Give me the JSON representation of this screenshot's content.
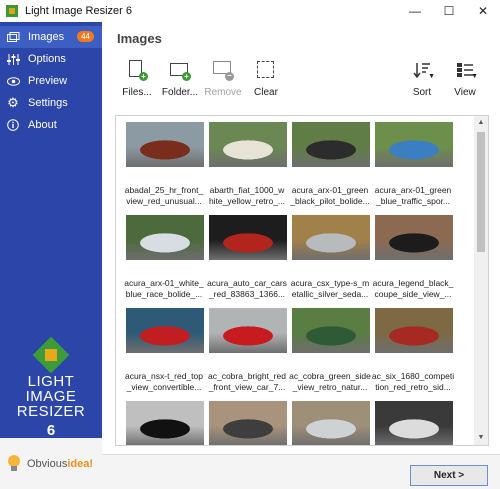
{
  "window": {
    "title": "Light Image Resizer 6",
    "buttons": [
      "minimize",
      "maximize",
      "close"
    ]
  },
  "sidebar": {
    "items": [
      {
        "label": "Images",
        "icon": "images-icon",
        "badge": "44",
        "active": true
      },
      {
        "label": "Options",
        "icon": "sliders-icon"
      },
      {
        "label": "Preview",
        "icon": "eye-icon"
      },
      {
        "label": "Settings",
        "icon": "gear-icon"
      },
      {
        "label": "About",
        "icon": "info-icon"
      }
    ],
    "logo": {
      "line1": "LIGHT",
      "line2": "IMAGE",
      "line3": "RESIZER",
      "version": "6"
    },
    "brand": {
      "part1": "Obvious",
      "part2": "idea!"
    }
  },
  "main": {
    "title": "Images",
    "toolbar": {
      "files": "Files...",
      "folder": "Folder...",
      "remove": "Remove",
      "clear": "Clear",
      "sort": "Sort",
      "view": "View"
    },
    "images": [
      {
        "caption1": "abadal_25_hr_front_",
        "caption2": "view_red_unusual...",
        "colors": [
          "#8c9aa3",
          "#7a2d1c"
        ]
      },
      {
        "caption1": "abarth_fiat_1000_w",
        "caption2": "hite_yellow_retro_...",
        "colors": [
          "#6a8754",
          "#e7e3d6"
        ]
      },
      {
        "caption1": "acura_arx-01_green",
        "caption2": "_black_pilot_bolide...",
        "colors": [
          "#5f7d45",
          "#2c2c2c"
        ]
      },
      {
        "caption1": "acura_arx-01_green",
        "caption2": "_blue_traffic_spor...",
        "colors": [
          "#6d8f4c",
          "#3b7ec2"
        ]
      },
      {
        "caption1": "acura_arx-01_white_",
        "caption2": "blue_race_bolide_...",
        "colors": [
          "#4c6a3b",
          "#d8dde3"
        ]
      },
      {
        "caption1": "acura_auto_car_cars",
        "caption2": "_red_83863_1366...",
        "colors": [
          "#1d1d1d",
          "#b3251c"
        ]
      },
      {
        "caption1": "acura_csx_type-s_m",
        "caption2": "etallic_silver_seda...",
        "colors": [
          "#a2804a",
          "#b8bbbe"
        ]
      },
      {
        "caption1": "acura_legend_black_",
        "caption2": "coupe_side_view_...",
        "colors": [
          "#8c6a52",
          "#1c1c1c"
        ]
      },
      {
        "caption1": "acura_nsx-t_red_top",
        "caption2": "_view_convertible...",
        "colors": [
          "#2e5a78",
          "#c21d21"
        ]
      },
      {
        "caption1": "ac_cobra_bright_red",
        "caption2": "_front_view_car_7...",
        "colors": [
          "#b0b4b5",
          "#c81b20"
        ]
      },
      {
        "caption1": "ac_cobra_green_side",
        "caption2": "_view_retro_natur...",
        "colors": [
          "#597d43",
          "#2f5a36"
        ]
      },
      {
        "caption1": "ac_six_1680_competi",
        "caption2": "tion_red_retro_sid...",
        "colors": [
          "#7d6a45",
          "#a62a22"
        ]
      },
      {
        "caption1": "",
        "caption2": "",
        "colors": [
          "#bfbfbf",
          "#111111"
        ]
      },
      {
        "caption1": "",
        "caption2": "",
        "colors": [
          "#a9937c",
          "#3e3e3e"
        ]
      },
      {
        "caption1": "",
        "caption2": "",
        "colors": [
          "#9e8f78",
          "#cfd2d4"
        ]
      },
      {
        "caption1": "",
        "caption2": "",
        "colors": [
          "#3a3a3a",
          "#dcdcdc"
        ]
      }
    ],
    "next_button": "Next >"
  }
}
